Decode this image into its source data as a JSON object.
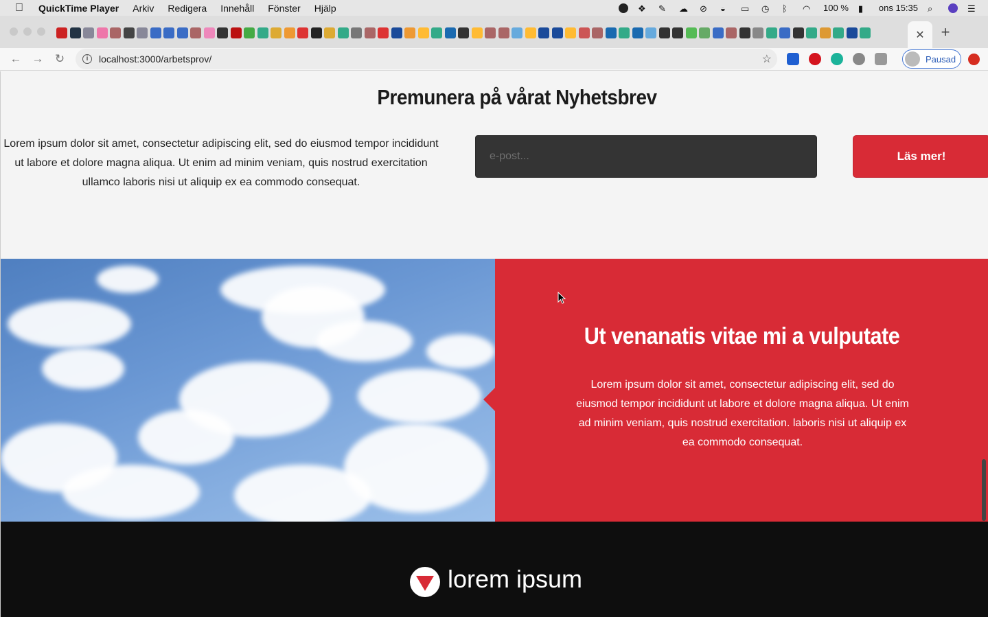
{
  "menubar": {
    "app_name": "QuickTime Player",
    "menus": [
      "Arkiv",
      "Redigera",
      "Innehåll",
      "Fönster",
      "Hjälp"
    ],
    "battery": "100 %",
    "clock": "ons 15:35"
  },
  "browser": {
    "url": "localhost:3000/arbetsprov/",
    "profile_label": "Pausad",
    "close_tab_glyph": "✕",
    "new_tab_glyph": "+"
  },
  "newsletter": {
    "title": "Premunera på vårat Nyhetsbrev",
    "text": "Lorem ipsum dolor sit amet, consectetur adipiscing elit, sed do eiusmod tempor incididunt ut labore et dolore magna aliqua. Ut enim ad minim veniam, quis nostrud exercitation ullamco laboris nisi ut aliquip ex ea commodo consequat.",
    "email_placeholder": "e-post...",
    "button_label": "Läs mer!"
  },
  "feature": {
    "title": "Ut venanatis vitae mi a vulputate",
    "text": "Lorem ipsum dolor sit amet, consectetur adipiscing elit, sed do eiusmod tempor incididunt ut labore et dolore magna aliqua. Ut enim ad minim veniam, quis nostrud exercitation. laboris nisi ut aliquip ex ea commodo consequat."
  },
  "footer": {
    "logo_text": "lorem ipsum"
  },
  "colors": {
    "accent_red": "#d82b36",
    "footer_bg": "#0e0e0e",
    "input_bg": "#343434"
  }
}
